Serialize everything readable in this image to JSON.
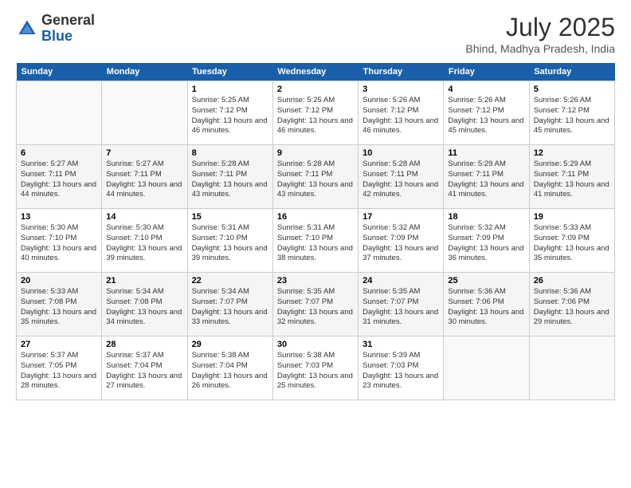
{
  "header": {
    "logo_general": "General",
    "logo_blue": "Blue",
    "title": "July 2025",
    "subtitle": "Bhind, Madhya Pradesh, India"
  },
  "calendar": {
    "days_of_week": [
      "Sunday",
      "Monday",
      "Tuesday",
      "Wednesday",
      "Thursday",
      "Friday",
      "Saturday"
    ],
    "weeks": [
      [
        {
          "day": "",
          "info": ""
        },
        {
          "day": "",
          "info": ""
        },
        {
          "day": "1",
          "sunrise": "5:25 AM",
          "sunset": "7:12 PM",
          "daylight": "13 hours and 46 minutes."
        },
        {
          "day": "2",
          "sunrise": "5:25 AM",
          "sunset": "7:12 PM",
          "daylight": "13 hours and 46 minutes."
        },
        {
          "day": "3",
          "sunrise": "5:26 AM",
          "sunset": "7:12 PM",
          "daylight": "13 hours and 46 minutes."
        },
        {
          "day": "4",
          "sunrise": "5:26 AM",
          "sunset": "7:12 PM",
          "daylight": "13 hours and 45 minutes."
        },
        {
          "day": "5",
          "sunrise": "5:26 AM",
          "sunset": "7:12 PM",
          "daylight": "13 hours and 45 minutes."
        }
      ],
      [
        {
          "day": "6",
          "sunrise": "5:27 AM",
          "sunset": "7:11 PM",
          "daylight": "13 hours and 44 minutes."
        },
        {
          "day": "7",
          "sunrise": "5:27 AM",
          "sunset": "7:11 PM",
          "daylight": "13 hours and 44 minutes."
        },
        {
          "day": "8",
          "sunrise": "5:28 AM",
          "sunset": "7:11 PM",
          "daylight": "13 hours and 43 minutes."
        },
        {
          "day": "9",
          "sunrise": "5:28 AM",
          "sunset": "7:11 PM",
          "daylight": "13 hours and 43 minutes."
        },
        {
          "day": "10",
          "sunrise": "5:28 AM",
          "sunset": "7:11 PM",
          "daylight": "13 hours and 42 minutes."
        },
        {
          "day": "11",
          "sunrise": "5:29 AM",
          "sunset": "7:11 PM",
          "daylight": "13 hours and 41 minutes."
        },
        {
          "day": "12",
          "sunrise": "5:29 AM",
          "sunset": "7:11 PM",
          "daylight": "13 hours and 41 minutes."
        }
      ],
      [
        {
          "day": "13",
          "sunrise": "5:30 AM",
          "sunset": "7:10 PM",
          "daylight": "13 hours and 40 minutes."
        },
        {
          "day": "14",
          "sunrise": "5:30 AM",
          "sunset": "7:10 PM",
          "daylight": "13 hours and 39 minutes."
        },
        {
          "day": "15",
          "sunrise": "5:31 AM",
          "sunset": "7:10 PM",
          "daylight": "13 hours and 39 minutes."
        },
        {
          "day": "16",
          "sunrise": "5:31 AM",
          "sunset": "7:10 PM",
          "daylight": "13 hours and 38 minutes."
        },
        {
          "day": "17",
          "sunrise": "5:32 AM",
          "sunset": "7:09 PM",
          "daylight": "13 hours and 37 minutes."
        },
        {
          "day": "18",
          "sunrise": "5:32 AM",
          "sunset": "7:09 PM",
          "daylight": "13 hours and 36 minutes."
        },
        {
          "day": "19",
          "sunrise": "5:33 AM",
          "sunset": "7:09 PM",
          "daylight": "13 hours and 35 minutes."
        }
      ],
      [
        {
          "day": "20",
          "sunrise": "5:33 AM",
          "sunset": "7:08 PM",
          "daylight": "13 hours and 35 minutes."
        },
        {
          "day": "21",
          "sunrise": "5:34 AM",
          "sunset": "7:08 PM",
          "daylight": "13 hours and 34 minutes."
        },
        {
          "day": "22",
          "sunrise": "5:34 AM",
          "sunset": "7:07 PM",
          "daylight": "13 hours and 33 minutes."
        },
        {
          "day": "23",
          "sunrise": "5:35 AM",
          "sunset": "7:07 PM",
          "daylight": "13 hours and 32 minutes."
        },
        {
          "day": "24",
          "sunrise": "5:35 AM",
          "sunset": "7:07 PM",
          "daylight": "13 hours and 31 minutes."
        },
        {
          "day": "25",
          "sunrise": "5:36 AM",
          "sunset": "7:06 PM",
          "daylight": "13 hours and 30 minutes."
        },
        {
          "day": "26",
          "sunrise": "5:36 AM",
          "sunset": "7:06 PM",
          "daylight": "13 hours and 29 minutes."
        }
      ],
      [
        {
          "day": "27",
          "sunrise": "5:37 AM",
          "sunset": "7:05 PM",
          "daylight": "13 hours and 28 minutes."
        },
        {
          "day": "28",
          "sunrise": "5:37 AM",
          "sunset": "7:04 PM",
          "daylight": "13 hours and 27 minutes."
        },
        {
          "day": "29",
          "sunrise": "5:38 AM",
          "sunset": "7:04 PM",
          "daylight": "13 hours and 26 minutes."
        },
        {
          "day": "30",
          "sunrise": "5:38 AM",
          "sunset": "7:03 PM",
          "daylight": "13 hours and 25 minutes."
        },
        {
          "day": "31",
          "sunrise": "5:39 AM",
          "sunset": "7:03 PM",
          "daylight": "13 hours and 23 minutes."
        },
        {
          "day": "",
          "info": ""
        },
        {
          "day": "",
          "info": ""
        }
      ]
    ]
  }
}
